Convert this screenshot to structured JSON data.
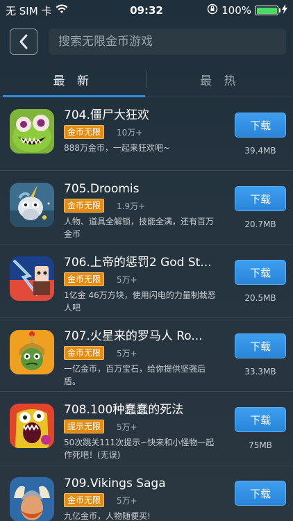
{
  "status_bar": {
    "carrier": "无 SIM 卡",
    "time": "09:32",
    "battery": "100%"
  },
  "search": {
    "placeholder": "搜索无限金币游戏"
  },
  "tabs": [
    {
      "label": "最 新",
      "active": true
    },
    {
      "label": "最 热",
      "active": false
    }
  ],
  "download_label": "下载",
  "apps": [
    {
      "title": "704.僵尸大狂欢",
      "badge": "金币无限",
      "count": "10万+",
      "desc": "888万金币，一起来狂欢吧~",
      "size": "39.4MB",
      "icon": "zombie-icon"
    },
    {
      "title": "705.Droomis",
      "badge": "金币无限",
      "count": "1.9万+",
      "desc": "人物、道具全解锁，技能全满，还有百万金币",
      "size": "20.7MB",
      "icon": "unicorn-icon"
    },
    {
      "title": "706.上帝的惩罚2 God St...",
      "badge": "金币无限",
      "count": "5万+",
      "desc": "1亿金 46万方块，使用闪电的力量制裁恶人吧",
      "size": "20.5MB",
      "icon": "lightning-icon"
    },
    {
      "title": "707.火星来的罗马人 Ro...",
      "badge": "金币无限",
      "count": "5万+",
      "desc": "一亿金币，百万宝石，给你提供坚强后盾。",
      "size": "33.3MB",
      "icon": "roman-icon"
    },
    {
      "title": "708.100种蠢蠢的死法",
      "badge": "提示无限",
      "count": "5万+",
      "desc": "50次跳关111次提示~快来和小怪物一起作死吧！(无误)",
      "size": "75MB",
      "icon": "monster-icon"
    },
    {
      "title": "709.Vikings Saga",
      "badge": "金币无限",
      "count": "5万+",
      "desc": "九亿金币，人物随便买!",
      "size": "",
      "icon": "viking-icon"
    }
  ]
}
